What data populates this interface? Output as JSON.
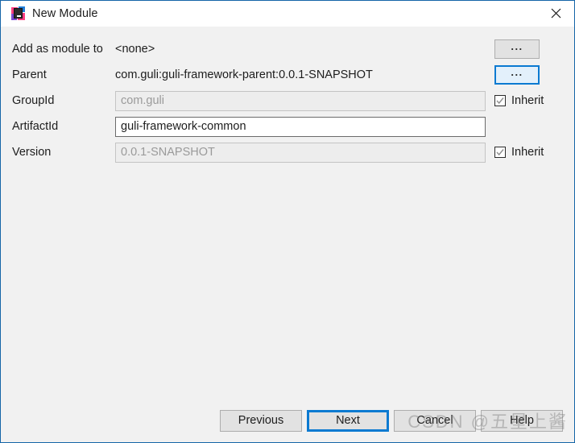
{
  "window": {
    "title": "New Module",
    "icon": "intellij-idea-icon",
    "close_label": "×",
    "accent_color": "#0b7ad1",
    "border_color": "#1565a8",
    "background_color": "#f1f1f1",
    "titlebar_color": "#ffffff"
  },
  "form": {
    "rows": [
      {
        "label": "Add as module to",
        "value": "<none>",
        "type": "text-plain",
        "right": "browse-button",
        "right_label": "...",
        "focused": false
      },
      {
        "label": "Parent",
        "value": "com.guli:guli-framework-parent:0.0.1-SNAPSHOT",
        "type": "text-plain",
        "right": "browse-button",
        "right_label": "...",
        "focused": true
      },
      {
        "label": "GroupId",
        "value": "com.guli",
        "type": "input-disabled",
        "right": "inherit-checkbox",
        "right_label": "Inherit",
        "checked": true
      },
      {
        "label": "ArtifactId",
        "value": "guli-framework-common",
        "type": "input-enabled",
        "right": "none",
        "right_label": "",
        "checked": false
      },
      {
        "label": "Version",
        "value": "0.0.1-SNAPSHOT",
        "type": "input-disabled",
        "right": "inherit-checkbox",
        "right_label": "Inherit",
        "checked": true
      }
    ]
  },
  "footer": {
    "buttons": [
      {
        "label": "Previous",
        "default": false
      },
      {
        "label": "Next",
        "default": true
      },
      {
        "label": "Cancel",
        "default": false
      },
      {
        "label": "Help",
        "default": false
      }
    ]
  },
  "watermark": {
    "text": "CSDN @五星上酱"
  }
}
